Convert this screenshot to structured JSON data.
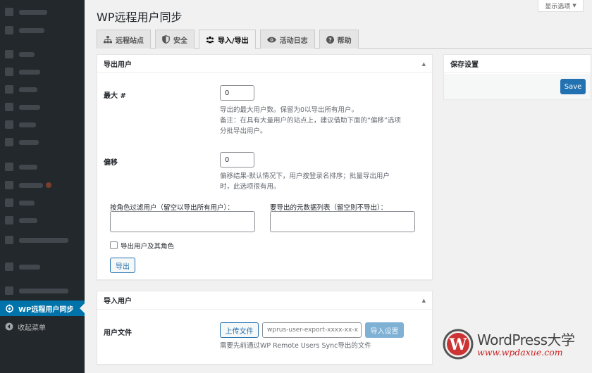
{
  "screen_options": {
    "label": "显示选项"
  },
  "page_title": "WP远程用户同步",
  "tabs": [
    {
      "label": "远程站点",
      "icon": "sitemap-icon",
      "active": false
    },
    {
      "label": "安全",
      "icon": "shield-icon",
      "active": false
    },
    {
      "label": "导入/导出",
      "icon": "groups-icon",
      "active": true
    },
    {
      "label": "活动日志",
      "icon": "eye-icon",
      "active": false
    },
    {
      "label": "帮助",
      "icon": "help-icon",
      "active": false
    }
  ],
  "sidebar": {
    "active_item": {
      "label": "WP远程用户同步",
      "icon": "sync-icon"
    },
    "collapse": {
      "label": "收起菜单",
      "icon": "collapse-icon"
    }
  },
  "export_box": {
    "title": "导出用户",
    "max_label": "最大 #",
    "max_value": "0",
    "max_desc_1": "导出的最大用户数。保留为0以导出所有用户。",
    "max_desc_2": "备注：在具有大量用户的站点上，建议借助下面的“偏移”选项",
    "max_desc_3": "分批导出用户。",
    "offset_label": "偏移",
    "offset_value": "0",
    "offset_desc_1": "偏移结果-默认情况下，用户按登录名排序；批量导出用户",
    "offset_desc_2": "时，此选项很有用。",
    "role_filter_label": "按角色过滤用户（留空以导出所有用户）：",
    "meta_keys_label": "要导出的元数据列表（留空则不导出）：",
    "with_roles_label": "导出用户及其角色",
    "export_button": "导出"
  },
  "import_box": {
    "title": "导入用户",
    "file_label": "用户文件",
    "upload_button": "上传文件",
    "file_placeholder": "wprus-user-export-xxxx-xx-x",
    "import_button": "导入设置",
    "file_desc": "需要先前通过WP Remote Users Sync导出的文件"
  },
  "save_box": {
    "title": "保存设置",
    "save_button": "Save"
  },
  "watermark": {
    "main": "WordPress大学",
    "url": "www.wpdaxue.com"
  },
  "colors": {
    "admin_bar": "#23282d",
    "active_menu": "#0073aa",
    "primary_button": "#2271b1",
    "watermark_url": "#cc2222"
  }
}
